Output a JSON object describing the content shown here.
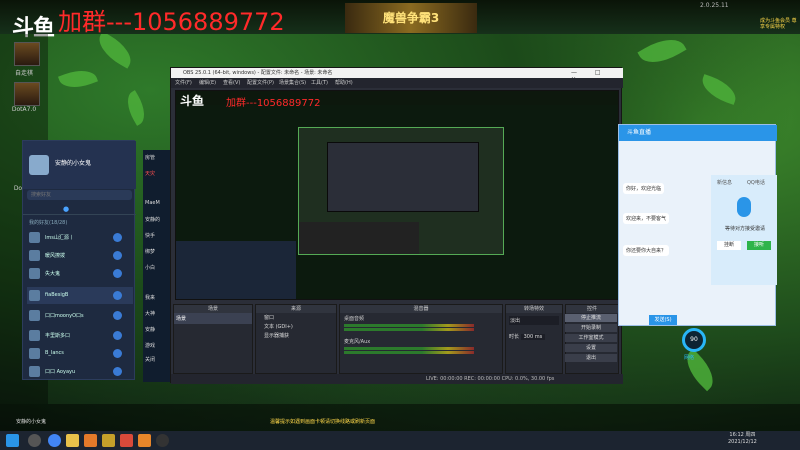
{
  "banner": {
    "logo": "斗鱼",
    "qq_group": "加群---1056889772",
    "ad_title": "魔兽争霸3",
    "version": "2.0.25.11",
    "gold_tip": "成为斗鱼会员 尊享专属特权"
  },
  "left_games": [
    {
      "label": "自走棋"
    },
    {
      "label": "DotA7.0"
    },
    {
      "label": "DotA..."
    }
  ],
  "friend_panel": {
    "user_name": "安静的小女鬼",
    "search_placeholder": "搜索好友",
    "group_label": "我的好友(18/28)",
    "friends": [
      {
        "name": "lms山汇源丨"
      },
      {
        "name": "暖风撩拨"
      },
      {
        "name": "失大鬼"
      },
      {
        "name": "fiaBesigB"
      },
      {
        "name": "口口moonyO口s"
      },
      {
        "name": "丰里斯多口"
      },
      {
        "name": "B_lancs"
      },
      {
        "name": "口口 Aoyayu"
      }
    ]
  },
  "chat_rows": [
    "房管",
    "天灾",
    "MaeM",
    "安静的",
    "快手",
    "绑梦",
    "小白",
    "我来",
    "大神",
    "安静",
    "游戏",
    "关闭"
  ],
  "obs": {
    "title": "OBS 25.0.1 (64-bit, windows) - 配置文件: 未命名 - 场景: 未命名",
    "menu": [
      "文件(F)",
      "编辑(E)",
      "查看(V)",
      "配置文件(P)",
      "场景集合(S)",
      "工具(T)",
      "帮助(H)"
    ],
    "docks": {
      "scenes": "场景",
      "sources": "来源",
      "mixer": "混音器",
      "transitions": "转场特效",
      "controls": "控件"
    },
    "scene_item": "场景",
    "sources": [
      "窗口",
      "文本 (GDI+)",
      "显示器捕获"
    ],
    "mixer_tracks": [
      "桌面音频",
      "麦克风/Aux"
    ],
    "transition": "淡出",
    "duration_label": "时长",
    "duration": "300 ms",
    "control_buttons": [
      "停止推流",
      "开始录制",
      "工作室模式",
      "设置",
      "退出"
    ],
    "status": "LIVE: 00:00:00  REC: 00:00:00  CPU: 0.0%, 30.00 fps"
  },
  "qq_call": {
    "title": "斗鱼直播",
    "messages": [
      "安静的小女鬼",
      "你好，欢迎光临",
      "欢迎来，不要客气",
      "你还要你大自来？"
    ],
    "call_labels": [
      "新信息",
      "QQ电话"
    ],
    "status": "等待对方接受邀请",
    "hangup": "挂断",
    "accept": "接听",
    "send": "发送(S)"
  },
  "gauge": "90",
  "gauge_sub": "网络",
  "notice": "温馨提示如遇到画面卡顿请切换线路或刷新页面",
  "clock": {
    "time": "16:12 周四",
    "date": "2021/12/12"
  }
}
